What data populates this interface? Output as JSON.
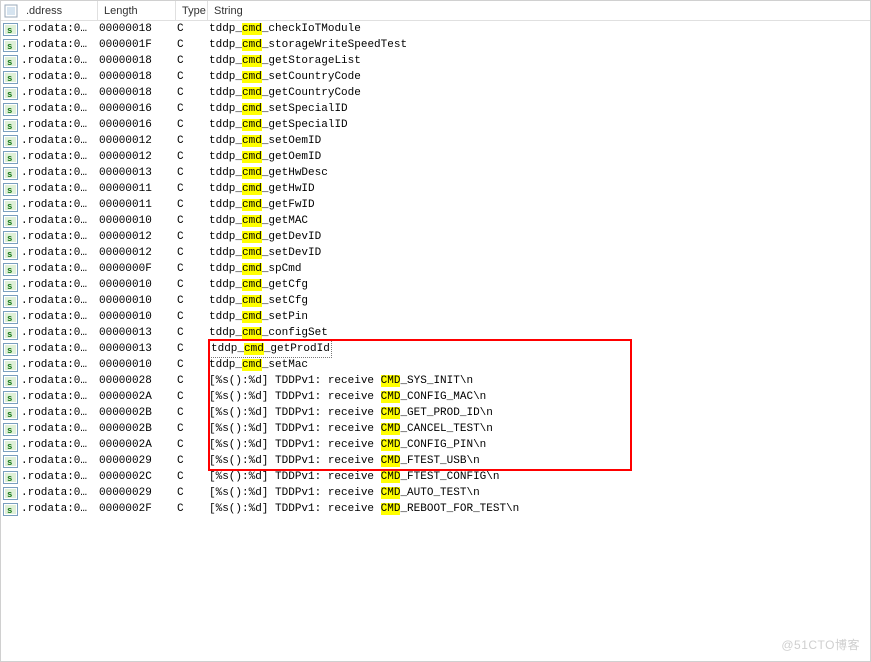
{
  "columns": {
    "address_label": ".ddress",
    "length_label": "Length",
    "type_label": "Type",
    "string_label": "String"
  },
  "icon_label": "s",
  "address_text": ".rodata:0…",
  "selected_index": 20,
  "redbox_first": 20,
  "redbox_last": 27,
  "rows": [
    {
      "length": "00000018",
      "type": "C",
      "pre": "tddp_",
      "hl": "cmd",
      "post": "_checkIoTModule"
    },
    {
      "length": "0000001F",
      "type": "C",
      "pre": "tddp_",
      "hl": "cmd",
      "post": "_storageWriteSpeedTest"
    },
    {
      "length": "00000018",
      "type": "C",
      "pre": "tddp_",
      "hl": "cmd",
      "post": "_getStorageList"
    },
    {
      "length": "00000018",
      "type": "C",
      "pre": "tddp_",
      "hl": "cmd",
      "post": "_setCountryCode"
    },
    {
      "length": "00000018",
      "type": "C",
      "pre": "tddp_",
      "hl": "cmd",
      "post": "_getCountryCode"
    },
    {
      "length": "00000016",
      "type": "C",
      "pre": "tddp_",
      "hl": "cmd",
      "post": "_setSpecialID"
    },
    {
      "length": "00000016",
      "type": "C",
      "pre": "tddp_",
      "hl": "cmd",
      "post": "_getSpecialID"
    },
    {
      "length": "00000012",
      "type": "C",
      "pre": "tddp_",
      "hl": "cmd",
      "post": "_setOemID"
    },
    {
      "length": "00000012",
      "type": "C",
      "pre": "tddp_",
      "hl": "cmd",
      "post": "_getOemID"
    },
    {
      "length": "00000013",
      "type": "C",
      "pre": "tddp_",
      "hl": "cmd",
      "post": "_getHwDesc"
    },
    {
      "length": "00000011",
      "type": "C",
      "pre": "tddp_",
      "hl": "cmd",
      "post": "_getHwID"
    },
    {
      "length": "00000011",
      "type": "C",
      "pre": "tddp_",
      "hl": "cmd",
      "post": "_getFwID"
    },
    {
      "length": "00000010",
      "type": "C",
      "pre": "tddp_",
      "hl": "cmd",
      "post": "_getMAC"
    },
    {
      "length": "00000012",
      "type": "C",
      "pre": "tddp_",
      "hl": "cmd",
      "post": "_getDevID"
    },
    {
      "length": "00000012",
      "type": "C",
      "pre": "tddp_",
      "hl": "cmd",
      "post": "_setDevID"
    },
    {
      "length": "0000000F",
      "type": "C",
      "pre": "tddp_",
      "hl": "cmd",
      "post": "_spCmd"
    },
    {
      "length": "00000010",
      "type": "C",
      "pre": "tddp_",
      "hl": "cmd",
      "post": "_getCfg"
    },
    {
      "length": "00000010",
      "type": "C",
      "pre": "tddp_",
      "hl": "cmd",
      "post": "_setCfg"
    },
    {
      "length": "00000010",
      "type": "C",
      "pre": "tddp_",
      "hl": "cmd",
      "post": "_setPin"
    },
    {
      "length": "00000013",
      "type": "C",
      "pre": "tddp_",
      "hl": "cmd",
      "post": "_configSet"
    },
    {
      "length": "00000013",
      "type": "C",
      "pre": "tddp_",
      "hl": "cmd",
      "post": "_getProdId"
    },
    {
      "length": "00000010",
      "type": "C",
      "pre": "tddp_",
      "hl": "cmd",
      "post": "_setMac"
    },
    {
      "length": "00000028",
      "type": "C",
      "pre": "[%s():%d] TDDPv1: receive ",
      "hl": "CMD",
      "post": "_SYS_INIT\\n"
    },
    {
      "length": "0000002A",
      "type": "C",
      "pre": "[%s():%d] TDDPv1: receive ",
      "hl": "CMD",
      "post": "_CONFIG_MAC\\n"
    },
    {
      "length": "0000002B",
      "type": "C",
      "pre": "[%s():%d] TDDPv1: receive ",
      "hl": "CMD",
      "post": "_GET_PROD_ID\\n"
    },
    {
      "length": "0000002B",
      "type": "C",
      "pre": "[%s():%d] TDDPv1: receive ",
      "hl": "CMD",
      "post": "_CANCEL_TEST\\n"
    },
    {
      "length": "0000002A",
      "type": "C",
      "pre": "[%s():%d] TDDPv1: receive ",
      "hl": "CMD",
      "post": "_CONFIG_PIN\\n"
    },
    {
      "length": "00000029",
      "type": "C",
      "pre": "[%s():%d] TDDPv1: receive ",
      "hl": "CMD",
      "post": "_FTEST_USB\\n"
    },
    {
      "length": "0000002C",
      "type": "C",
      "pre": "[%s():%d] TDDPv1: receive ",
      "hl": "CMD",
      "post": "_FTEST_CONFIG\\n"
    },
    {
      "length": "00000029",
      "type": "C",
      "pre": "[%s():%d] TDDPv1: receive ",
      "hl": "CMD",
      "post": "_AUTO_TEST\\n"
    },
    {
      "length": "0000002F",
      "type": "C",
      "pre": "[%s():%d] TDDPv1: receive ",
      "hl": "CMD",
      "post": "_REBOOT_FOR_TEST\\n"
    }
  ],
  "watermark": "@51CTO博客"
}
